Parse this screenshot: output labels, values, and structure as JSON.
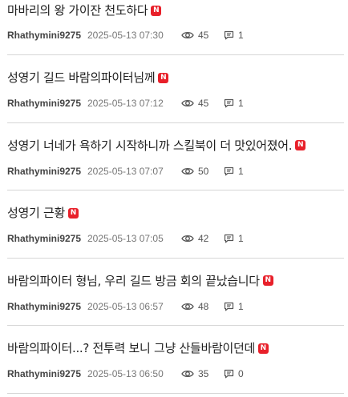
{
  "colors": {
    "badge_bg": "#e8202a",
    "divider": "#d6d6d6"
  },
  "icons": {
    "views": "eye-icon",
    "comments": "comment-icon"
  },
  "posts": [
    {
      "title": "마바리의 왕 가이잔 천도하다",
      "badge": "N",
      "author": "Rhathymini9275",
      "date": "2025-05-13 07:30",
      "views": "45",
      "comments": "1"
    },
    {
      "title": "성영기 길드 바람의파이터님께",
      "badge": "N",
      "author": "Rhathymini9275",
      "date": "2025-05-13 07:12",
      "views": "45",
      "comments": "1"
    },
    {
      "title": "성영기 너네가 욕하기 시작하니까 스킬북이 더 맛있어졌어.",
      "badge": "N",
      "author": "Rhathymini9275",
      "date": "2025-05-13 07:07",
      "views": "50",
      "comments": "1"
    },
    {
      "title": "성영기 근황",
      "badge": "N",
      "author": "Rhathymini9275",
      "date": "2025-05-13 07:05",
      "views": "42",
      "comments": "1"
    },
    {
      "title": "바람의파이터 형님, 우리 길드 방금 회의 끝났습니다",
      "badge": "N",
      "author": "Rhathymini9275",
      "date": "2025-05-13 06:57",
      "views": "48",
      "comments": "1"
    },
    {
      "title": "바람의파이터...? 전투력 보니 그냥 산들바람이던데",
      "badge": "N",
      "author": "Rhathymini9275",
      "date": "2025-05-13 06:50",
      "views": "35",
      "comments": "0"
    }
  ]
}
